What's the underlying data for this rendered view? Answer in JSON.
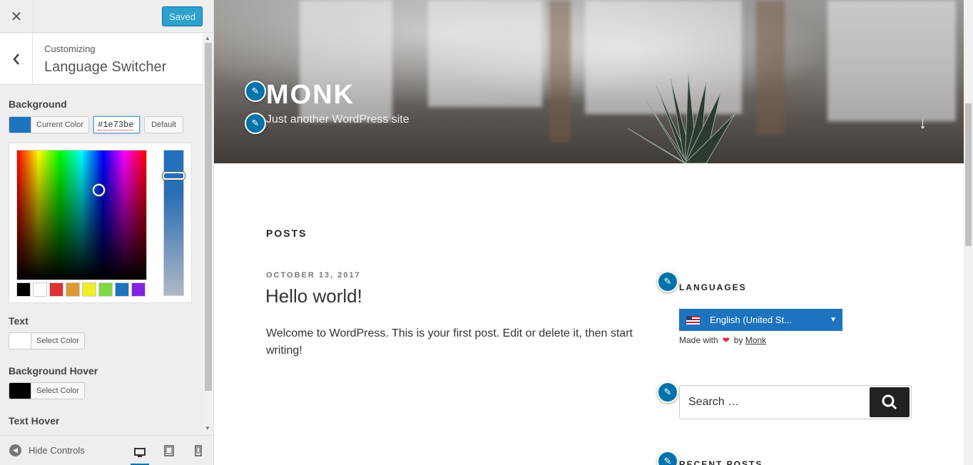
{
  "topbar": {
    "close_icon": "close-icon",
    "saved_label": "Saved"
  },
  "section": {
    "subtitle": "Customizing",
    "title": "Language Switcher",
    "back_icon": "chevron-left-icon"
  },
  "controls": {
    "background": {
      "label": "Background",
      "button_label": "Current Color",
      "swatch_color": "#1e73be",
      "hex_value": "#1e73be",
      "default_label": "Default",
      "palette": [
        "#000000",
        "#ffffff",
        "#dd3333",
        "#dd9933",
        "#eeee22",
        "#81d742",
        "#1e73be",
        "#8224e3"
      ]
    },
    "text": {
      "label": "Text",
      "button_label": "Select Color",
      "swatch_color": "#ffffff"
    },
    "background_hover": {
      "label": "Background Hover",
      "button_label": "Select Color",
      "swatch_color": "#000000"
    },
    "text_hover": {
      "label": "Text Hover"
    }
  },
  "footer": {
    "hide_controls_label": "Hide Controls",
    "devices": [
      "desktop-icon",
      "tablet-icon",
      "mobile-icon"
    ]
  },
  "preview": {
    "site_title": "MONK",
    "tagline": "Just another WordPress site",
    "posts_heading": "POSTS",
    "post": {
      "date": "OCTOBER 13, 2017",
      "title": "Hello world!",
      "body": "Welcome to WordPress. This is your first post. Edit or delete it, then start writing!"
    },
    "languages_heading": "LANGUAGES",
    "language_selected": "English (United St...",
    "made_with_prefix": "Made with",
    "made_with_by": "by",
    "made_with_link": "Monk",
    "search_placeholder": "Search …",
    "recent_posts_heading": "RECENT POSTS"
  },
  "colors": {
    "accent": "#0073aa",
    "switcher_bg": "#1e73be"
  }
}
